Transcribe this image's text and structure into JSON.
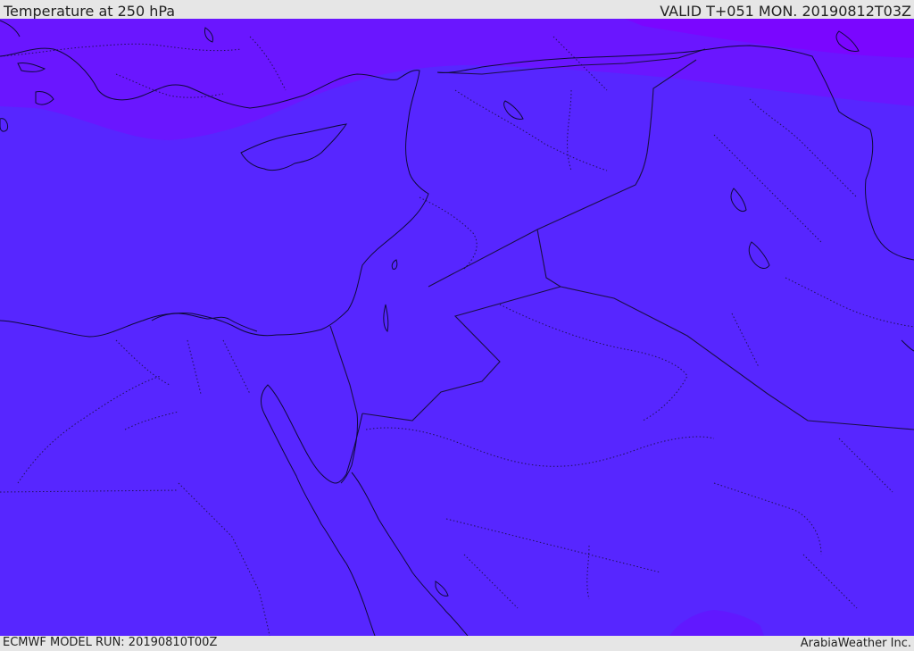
{
  "header": {
    "title": "Temperature at 250 hPa",
    "valid": "VALID T+051 MON. 20190812T03Z"
  },
  "footer": {
    "model_run": "ECMWF MODEL RUN: 20190810T00Z",
    "credit": "ArabiaWeather Inc."
  },
  "colors": {
    "field_main": "#5726ff",
    "field_north": "#6a16ff",
    "field_far_north": "#7a06ff",
    "field_south_patch": "#6118ff",
    "coastline": "#0f0a3a",
    "border": "#1a0f45"
  }
}
